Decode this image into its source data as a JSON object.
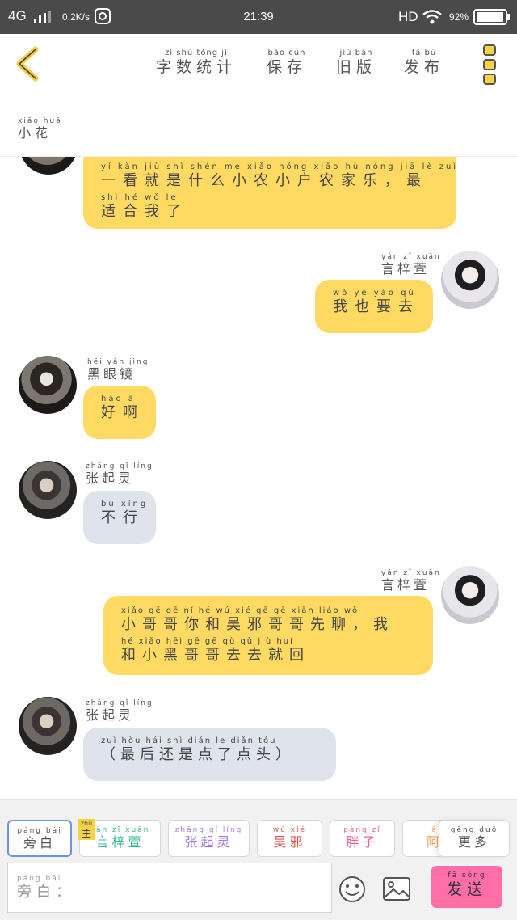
{
  "status_bar": {
    "network": "4G",
    "speed": "0.2K/s",
    "time": "21:39",
    "hd": "HD",
    "battery": "92%"
  },
  "header": {
    "back_icon": "chevron-left-icon",
    "buttons": [
      {
        "pinyin": "zì  shù  tǒng  jì",
        "text": "字数统计"
      },
      {
        "pinyin": "bǎo  cún",
        "text": "保存"
      },
      {
        "pinyin": "jiù  bǎn",
        "text": "旧版"
      },
      {
        "pinyin": "fā  bù",
        "text": "发布"
      }
    ],
    "menu_icon": "more-vertical-icon"
  },
  "room": {
    "pinyin": "xiǎo  huā",
    "name": "小花"
  },
  "messages": [
    {
      "lines": [
        {
          "pinyin": "yí  kàn  jiù  shì  shén  me  xiǎo  nóng  xiǎo  hù  nóng  jiā  lè     zuì",
          "text": "一看就是什么小农小户农家乐，最"
        },
        {
          "pinyin": "shì  hé  wǒ  le",
          "text": "适合我了"
        }
      ]
    },
    {
      "sender": {
        "pinyin": "yán  zǐ  xuān",
        "name": "言梓萱"
      },
      "lines": [
        {
          "pinyin": "wǒ  yě  yào  qù",
          "text": "我也要去"
        }
      ]
    },
    {
      "sender": {
        "pinyin": "hēi  yǎn  jìng",
        "name": "黑眼镜"
      },
      "lines": [
        {
          "pinyin": "hǎo  ā",
          "text": "好啊"
        }
      ]
    },
    {
      "sender": {
        "pinyin": "zhāng  qǐ  líng",
        "name": "张起灵"
      },
      "lines": [
        {
          "pinyin": "bù  xíng",
          "text": "不行"
        }
      ]
    },
    {
      "sender": {
        "pinyin": "yán  zǐ  xuān",
        "name": "言梓萱"
      },
      "lines": [
        {
          "pinyin": "xiǎo  gē  gē  nǐ  hé  wú  xié  gē  gē  xiān  liáo     wǒ",
          "text": "小哥哥你和吴邪哥哥先聊，我"
        },
        {
          "pinyin": "hé  xiǎo  hēi  gē  gē  qù  qù  jiù  huí",
          "text": "和小黑哥哥去去就回"
        }
      ]
    },
    {
      "sender": {
        "pinyin": "zhāng  qǐ  líng",
        "name": "张起灵"
      },
      "lines": [
        {
          "pinyin": "zuì  hòu  hái  shì  diǎn  le  diǎn  tóu",
          "text": "（最后还是点了点头）"
        }
      ]
    }
  ],
  "roles": [
    {
      "pinyin": "páng  bái",
      "text": "旁白",
      "color": "#555555"
    },
    {
      "badge_pinyin": "zhǔ",
      "badge": "主",
      "pinyin": "yán  zǐ  xuān",
      "text": "言梓萱",
      "color": "#39b59a"
    },
    {
      "pinyin": "zhāng  qǐ  líng",
      "text": "张起灵",
      "color": "#a77cd6"
    },
    {
      "pinyin": "wú  xié",
      "text": "吴邪",
      "color": "#e0554a"
    },
    {
      "pinyin": "pàng  zǐ",
      "text": "胖子",
      "color": "#ea5fa0"
    },
    {
      "pinyin": "ā",
      "text": "阿",
      "color": "#f0a35a"
    },
    {
      "pinyin": "gēng  duō",
      "text": "更多",
      "color": "#555555"
    }
  ],
  "input": {
    "pinyin": "páng  bái",
    "label": "旁白：",
    "emoji_icon": "smiley-icon",
    "image_icon": "image-icon"
  },
  "send": {
    "pinyin": "fā  sòng",
    "text": "发送"
  },
  "colors": {
    "bubble_yellow": "#ffda63",
    "bubble_grey": "#dfe4ec",
    "accent_yellow": "#f5d442",
    "send_pink": "#ff6fa6"
  }
}
